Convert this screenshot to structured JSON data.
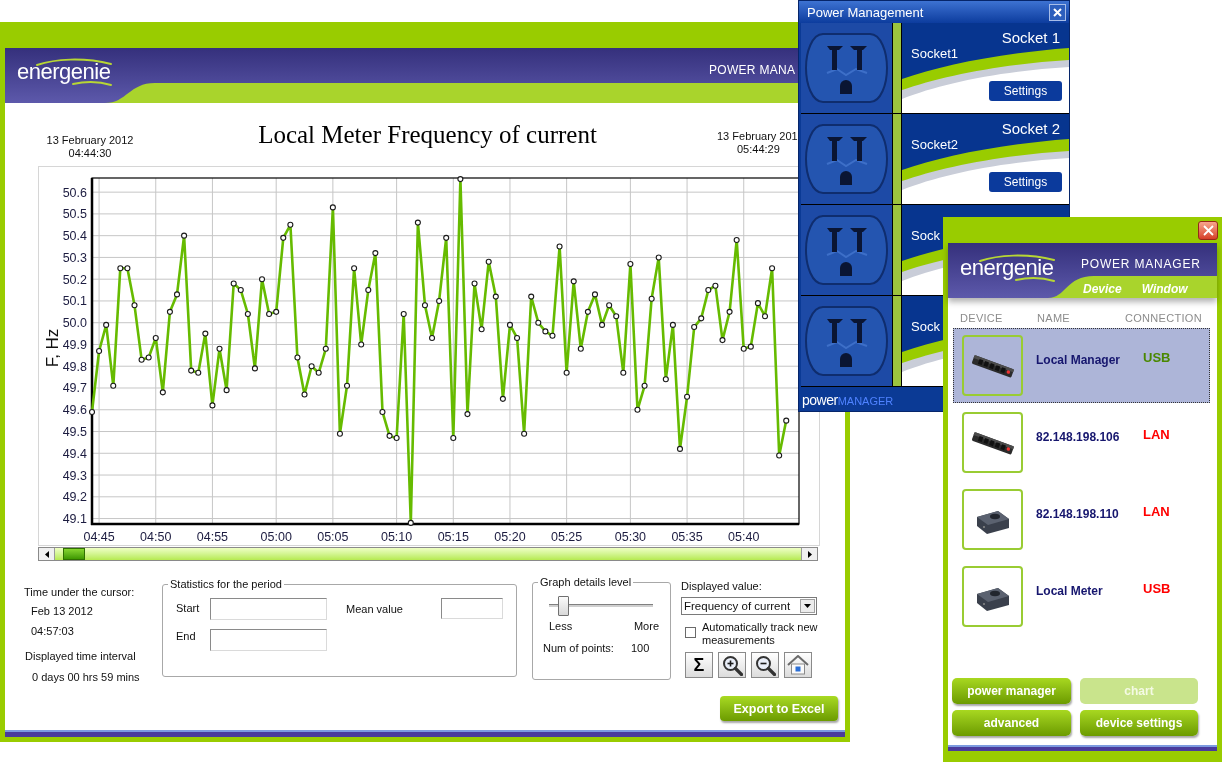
{
  "main_window": {
    "logo": "energenie",
    "header_title": "POWER MANA",
    "start_date": "13 February 2012",
    "start_time": "04:44:30",
    "chart_title": "Local Meter Frequency of current",
    "end_date": "13 February 201",
    "end_time": "05:44:29",
    "chart_data": {
      "type": "line",
      "ylabel": "F, Hz",
      "grid": true,
      "categories": [
        null,
        "04:45",
        null,
        null,
        null,
        null,
        null,
        null,
        null,
        "04:50",
        null,
        null,
        null,
        null,
        null,
        null,
        null,
        "04:55",
        null,
        null,
        null,
        null,
        null,
        null,
        null,
        null,
        "05:00",
        null,
        null,
        null,
        null,
        null,
        null,
        null,
        "05:05",
        null,
        null,
        null,
        null,
        null,
        null,
        null,
        null,
        "05:10",
        null,
        null,
        null,
        null,
        null,
        null,
        null,
        "05:15",
        null,
        null,
        null,
        null,
        null,
        null,
        null,
        "05:20",
        null,
        null,
        null,
        null,
        null,
        null,
        null,
        "05:25",
        null,
        null,
        null,
        null,
        null,
        null,
        null,
        null,
        "05:30",
        null,
        null,
        null,
        null,
        null,
        null,
        null,
        "05:35",
        null,
        null,
        null,
        null,
        null,
        null,
        null,
        "05:40",
        null,
        null,
        null,
        null,
        null,
        null
      ],
      "series": [
        {
          "color": "#66bb00",
          "marker": "circle",
          "values": [
            49.59,
            49.87,
            49.99,
            49.71,
            50.25,
            50.25,
            50.08,
            49.83,
            49.84,
            49.93,
            49.68,
            50.05,
            50.13,
            50.4,
            49.78,
            49.77,
            49.95,
            49.62,
            49.88,
            49.69,
            50.18,
            50.15,
            50.04,
            49.79,
            50.2,
            50.04,
            50.05,
            50.39,
            50.45,
            49.84,
            49.67,
            49.8,
            49.77,
            49.88,
            50.53,
            49.49,
            49.71,
            50.25,
            49.9,
            50.15,
            50.32,
            49.59,
            49.48,
            49.47,
            50.04,
            49.08,
            50.46,
            50.08,
            49.93,
            50.1,
            50.39,
            49.47,
            50.66,
            49.58,
            50.18,
            49.97,
            50.28,
            50.12,
            49.65,
            49.99,
            49.93,
            49.49,
            50.12,
            50.0,
            49.96,
            49.94,
            50.35,
            49.77,
            50.19,
            49.88,
            50.05,
            50.13,
            49.99,
            50.08,
            50.03,
            49.77,
            50.27,
            49.6,
            49.71,
            50.11,
            50.3,
            49.74,
            49.99,
            49.42,
            49.66,
            49.98,
            50.02,
            50.15,
            50.17,
            49.92,
            50.05,
            50.38,
            49.88,
            49.89,
            50.09,
            50.03,
            50.25,
            49.39,
            49.55
          ]
        }
      ],
      "ylim": [
        49.075,
        50.665
      ],
      "yticks": [
        {
          "value": 49.1,
          "label": "49.1"
        },
        {
          "value": 49.2,
          "label": "49.2"
        },
        {
          "value": 49.3,
          "label": "49.3"
        },
        {
          "value": 49.4,
          "label": "49.4"
        },
        {
          "value": 49.5,
          "label": "49.5"
        },
        {
          "value": 49.6,
          "label": "49.6"
        },
        {
          "value": 49.7,
          "label": "49.7"
        },
        {
          "value": 49.8,
          "label": "49.8"
        },
        {
          "value": 49.9,
          "label": "49.9"
        },
        {
          "value": 50.0,
          "label": "50.0"
        },
        {
          "value": 50.1,
          "label": "50.1"
        },
        {
          "value": 50.2,
          "label": "50.2"
        },
        {
          "value": 50.3,
          "label": "50.3"
        },
        {
          "value": 50.4,
          "label": "50.4"
        },
        {
          "value": 50.5,
          "label": "50.5"
        },
        {
          "value": 50.6,
          "label": "50.6"
        }
      ]
    },
    "cursor": {
      "label": "Time under the cursor:",
      "date": "Feb 13 2012",
      "time": "04:57:03"
    },
    "interval": {
      "label": "Displayed time interval",
      "value": "0 days 00 hrs 59 mins"
    },
    "statistics": {
      "title": "Statistics for the period",
      "start": {
        "label": "Start"
      },
      "end": {
        "label": "End"
      },
      "mean": {
        "label": "Mean value"
      }
    },
    "graph_details": {
      "title": "Graph details level",
      "level": 0.1,
      "min_label": "Less",
      "max_label": "More",
      "points_label": "Num of points:",
      "points_value": "100"
    },
    "displayed_value": {
      "label": "Displayed value:",
      "value": "Frequency of current"
    },
    "auto_track": {
      "label": "Automatically track new measurements",
      "checked": false
    },
    "tools": [
      {
        "kind": "sum",
        "label": "Σ"
      },
      {
        "kind": "zoom_in"
      },
      {
        "kind": "zoom_out"
      },
      {
        "kind": "home"
      }
    ],
    "export_button": "Export to Excel"
  },
  "power_management": {
    "title": "Power Management",
    "sockets": [
      {
        "title": "Socket 1",
        "name": "Socket1",
        "button": "Settings"
      },
      {
        "title": "Socket 2",
        "name": "Socket2",
        "button": "Settings"
      },
      {
        "name": "Sock"
      },
      {
        "name": "Sock"
      }
    ],
    "footer": {
      "prefix": "power",
      "suffix": "MANAGER"
    }
  },
  "power_manager": {
    "logo": "energenie",
    "title": "POWER MANAGER",
    "menu": [
      "Device",
      "Window"
    ],
    "columns": [
      "DEVICE",
      "NAME",
      "CONNECTION"
    ],
    "devices": [
      {
        "kind": "strip",
        "name": "Local Manager",
        "connection": "USB",
        "color": "#4a8800",
        "selected": true
      },
      {
        "kind": "strip",
        "name": "82.148.198.106",
        "connection": "LAN",
        "color": "#ff0000",
        "selected": false
      },
      {
        "kind": "adapter",
        "name": "82.148.198.110",
        "connection": "LAN",
        "color": "#ff0000",
        "selected": false
      },
      {
        "kind": "adapter",
        "name": "Local Meter",
        "connection": "USB",
        "color": "#ff0000",
        "selected": false
      }
    ],
    "buttons": [
      {
        "label": "power manager",
        "disabled": false
      },
      {
        "label": "chart",
        "disabled": true
      },
      {
        "label": "advanced",
        "disabled": false
      },
      {
        "label": "device settings",
        "disabled": false
      }
    ]
  }
}
